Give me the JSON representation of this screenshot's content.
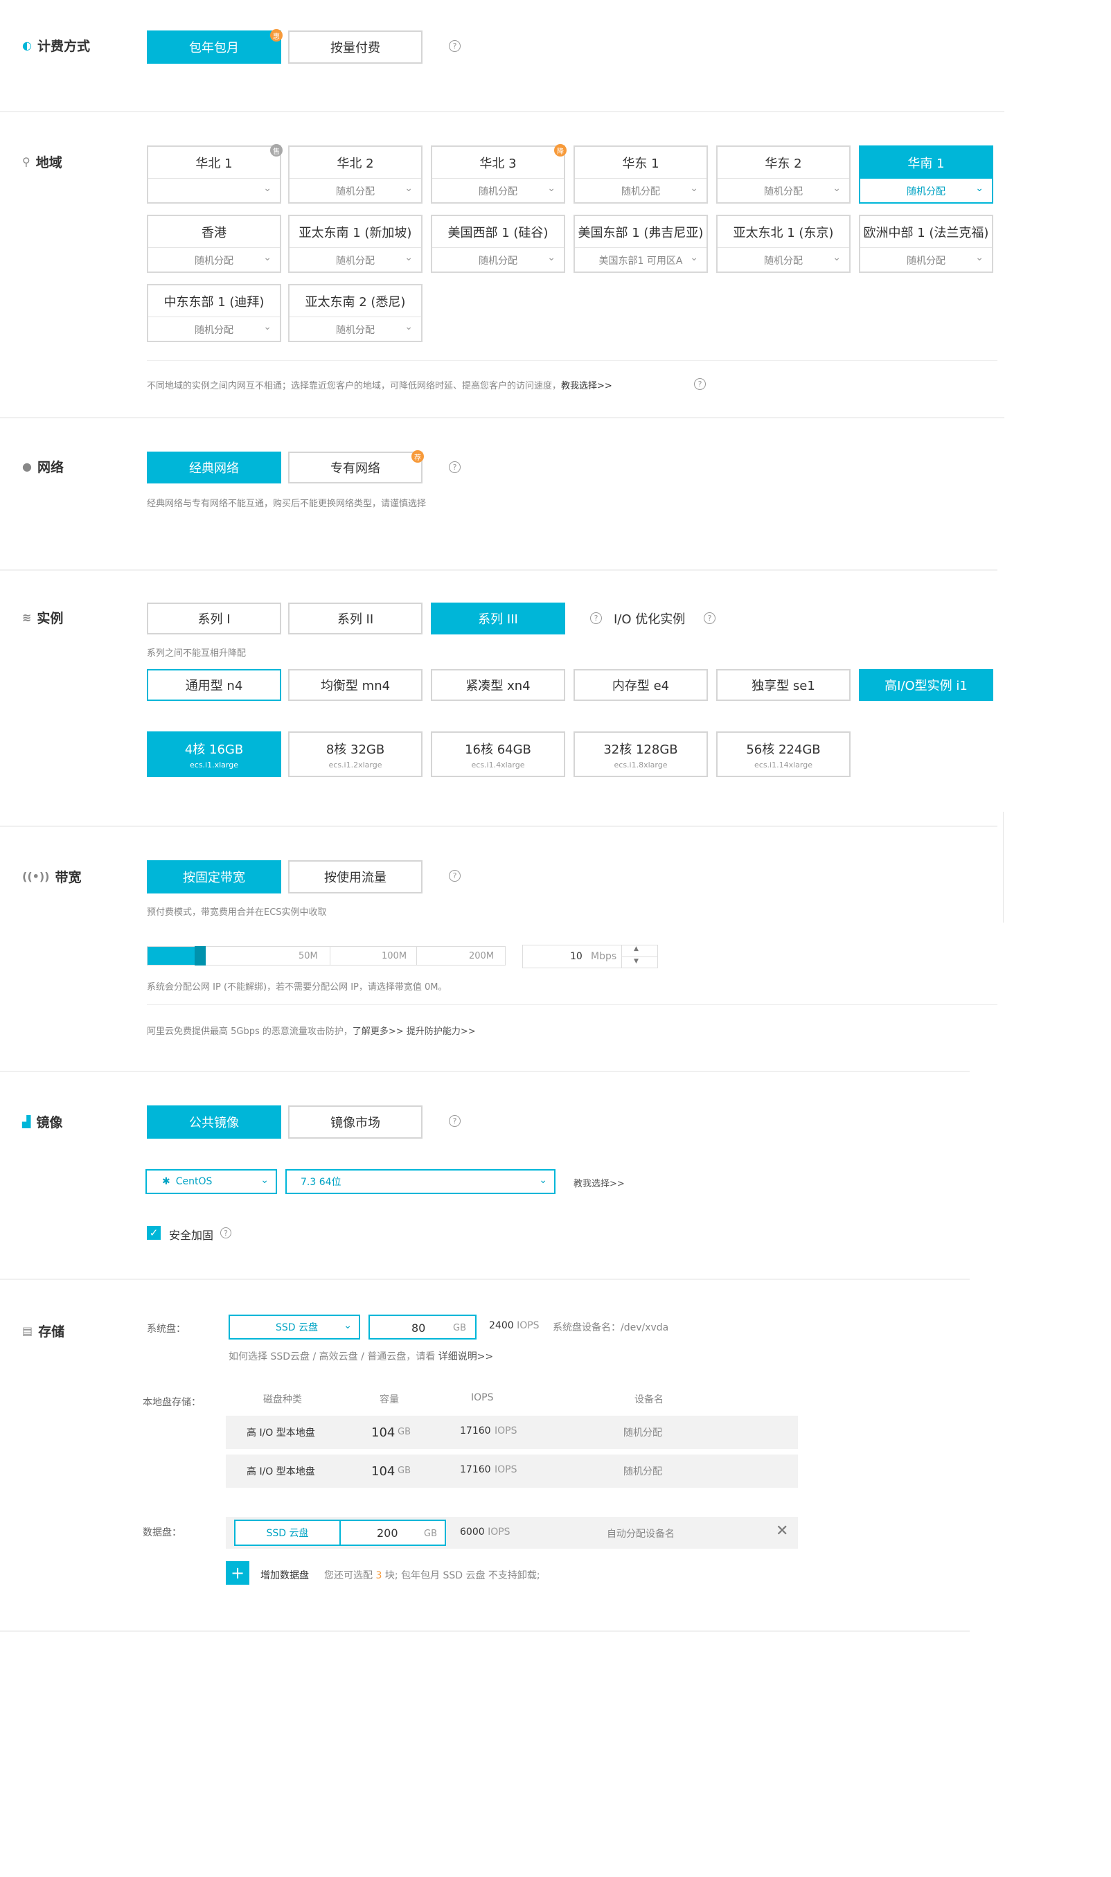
{
  "billing": {
    "title": "计费方式",
    "options": [
      "包年包月",
      "按量付费"
    ],
    "badge": "惠"
  },
  "region": {
    "title": "地域",
    "items": [
      {
        "name": "华北 1",
        "zone": ""
      },
      {
        "name": "华北 2",
        "zone": "随机分配"
      },
      {
        "name": "华北 3",
        "zone": "随机分配"
      },
      {
        "name": "华东 1",
        "zone": "随机分配"
      },
      {
        "name": "华东 2",
        "zone": "随机分配"
      },
      {
        "name": "华南 1",
        "zone": "随机分配"
      },
      {
        "name": "香港",
        "zone": "随机分配"
      },
      {
        "name": "亚太东南 1 (新加坡)",
        "zone": "随机分配"
      },
      {
        "name": "美国西部 1 (硅谷)",
        "zone": "随机分配"
      },
      {
        "name": "美国东部 1 (弗吉尼亚)",
        "zone": "美国东部1 可用区A"
      },
      {
        "name": "亚太东北 1 (东京)",
        "zone": "随机分配"
      },
      {
        "name": "欧洲中部 1 (法兰克福)",
        "zone": "随机分配"
      },
      {
        "name": "中东东部 1 (迪拜)",
        "zone": "随机分配"
      },
      {
        "name": "亚太东南 2 (悉尼)",
        "zone": "随机分配"
      }
    ],
    "badge_grey": "售",
    "badge_orange": "降",
    "note": "不同地域的实例之间内网互不相通；选择靠近您客户的地域，可降低网络时延、提高您客户的访问速度，",
    "note_link": "教我选择>>"
  },
  "network": {
    "title": "网络",
    "options": [
      "经典网络",
      "专有网络"
    ],
    "badge": "荐",
    "note": "经典网络与专有网络不能互通，购买后不能更换网络类型，请谨慎选择"
  },
  "instance": {
    "title": "实例",
    "series": [
      "系列 I",
      "系列 II",
      "系列 III"
    ],
    "io_label": "I/O 优化实例",
    "note": "系列之间不能互相升降配",
    "families": [
      "通用型 n4",
      "均衡型 mn4",
      "紧凑型 xn4",
      "内存型 e4",
      "独享型 se1",
      "高I/O型实例 i1"
    ],
    "specs": [
      {
        "t": "4核 16GB",
        "s": "ecs.i1.xlarge"
      },
      {
        "t": "8核 32GB",
        "s": "ecs.i1.2xlarge"
      },
      {
        "t": "16核 64GB",
        "s": "ecs.i1.4xlarge"
      },
      {
        "t": "32核 128GB",
        "s": "ecs.i1.8xlarge"
      },
      {
        "t": "56核 224GB",
        "s": "ecs.i1.14xlarge"
      }
    ]
  },
  "bandwidth": {
    "title": "带宽",
    "options": [
      "按固定带宽",
      "按使用流量"
    ],
    "note": "预付费模式，带宽费用合并在ECS实例中收取",
    "marks": [
      "50M",
      "100M",
      "200M"
    ],
    "value": "10",
    "unit": "Mbps",
    "slider_fraction": 0.05,
    "ip_note": "系统会分配公网 IP (不能解绑)，若不需要分配公网 IP，请选择带宽值 0M。",
    "ddos_note": "阿里云免费提供最高 5Gbps 的恶意流量攻击防护，",
    "ddos_link1": "了解更多>>",
    "ddos_link2": "提升防护能力>>"
  },
  "image": {
    "title": "镜像",
    "options": [
      "公共镜像",
      "镜像市场"
    ],
    "os": "CentOS",
    "version": "7.3 64位",
    "help_link": "教我选择>>",
    "security": "安全加固"
  },
  "storage": {
    "title": "存储",
    "system_label": "系统盘：",
    "system_type": "SSD 云盘",
    "system_size": "80",
    "gb": "GB",
    "system_iops_num": "2400",
    "iops": "IOPS",
    "system_device": "系统盘设备名：/dev/xvda",
    "system_help": "如何选择 SSD云盘 / 高效云盘 / 普通云盘，请看",
    "system_help_link": "详细说明>>",
    "local_label": "本地盘存储：",
    "local_headers": [
      "磁盘种类",
      "容量",
      "IOPS",
      "设备名"
    ],
    "local_rows": [
      {
        "type": "高 I/O 型本地盘",
        "size": "104",
        "iops": "17160",
        "device": "随机分配"
      },
      {
        "type": "高 I/O 型本地盘",
        "size": "104",
        "iops": "17160",
        "device": "随机分配"
      }
    ],
    "data_label": "数据盘：",
    "data_type": "SSD 云盘",
    "data_size": "200",
    "data_iops_num": "6000",
    "data_device": "自动分配设备名",
    "add_label": "增加数据盘",
    "add_note_pre": "您还可选配",
    "add_note_num": "3",
    "add_note_post": "块; 包年包月 SSD 云盘 不支持卸载;"
  },
  "colors": {
    "accent": "#00b6d8",
    "badge": "#f79a3a"
  }
}
